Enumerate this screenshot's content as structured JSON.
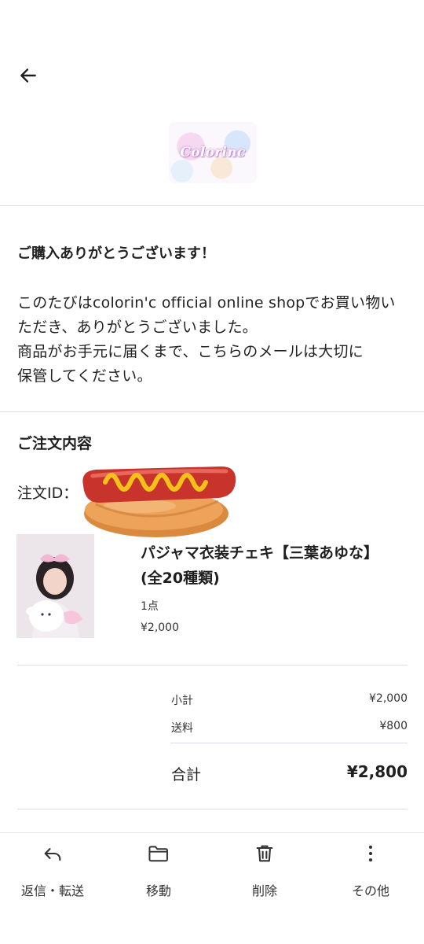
{
  "header": {
    "back_icon": "arrow-left-icon",
    "logo_text": "Colorinc"
  },
  "message": {
    "title": "ご購入ありがとうございます！",
    "lines": [
      "このたびはcolorin'c official online shopでお買い物い",
      "ただき、ありがとうございました。",
      "商品がお手元に届くまで、こちらのメールは大切に",
      "保管してください。"
    ]
  },
  "order": {
    "section_title": "ご注文内容",
    "id_label": "注文ID：",
    "item": {
      "name_lines": [
        "パジャマ衣装チェキ【三葉あゆな】",
        "(全20種類)"
      ],
      "quantity": "1点",
      "price": "¥2,000"
    },
    "summary": {
      "subtotal_label": "小計",
      "subtotal_value": "¥2,000",
      "shipping_label": "送料",
      "shipping_value": "¥800",
      "total_label": "合計",
      "total_value": "¥2,800"
    }
  },
  "toolbar": {
    "reply_label": "返信・転送",
    "move_label": "移動",
    "delete_label": "削除",
    "more_label": "その他",
    "icons": [
      "reply-icon",
      "folder-icon",
      "trash-icon",
      "more-vertical-icon"
    ]
  },
  "colors": {
    "divider": "#dcdde4",
    "text": "#1f1f1f",
    "hotdog_sausage": "#c8332c",
    "hotdog_bun": "#e59a4a",
    "mustard": "#f3c21a"
  }
}
